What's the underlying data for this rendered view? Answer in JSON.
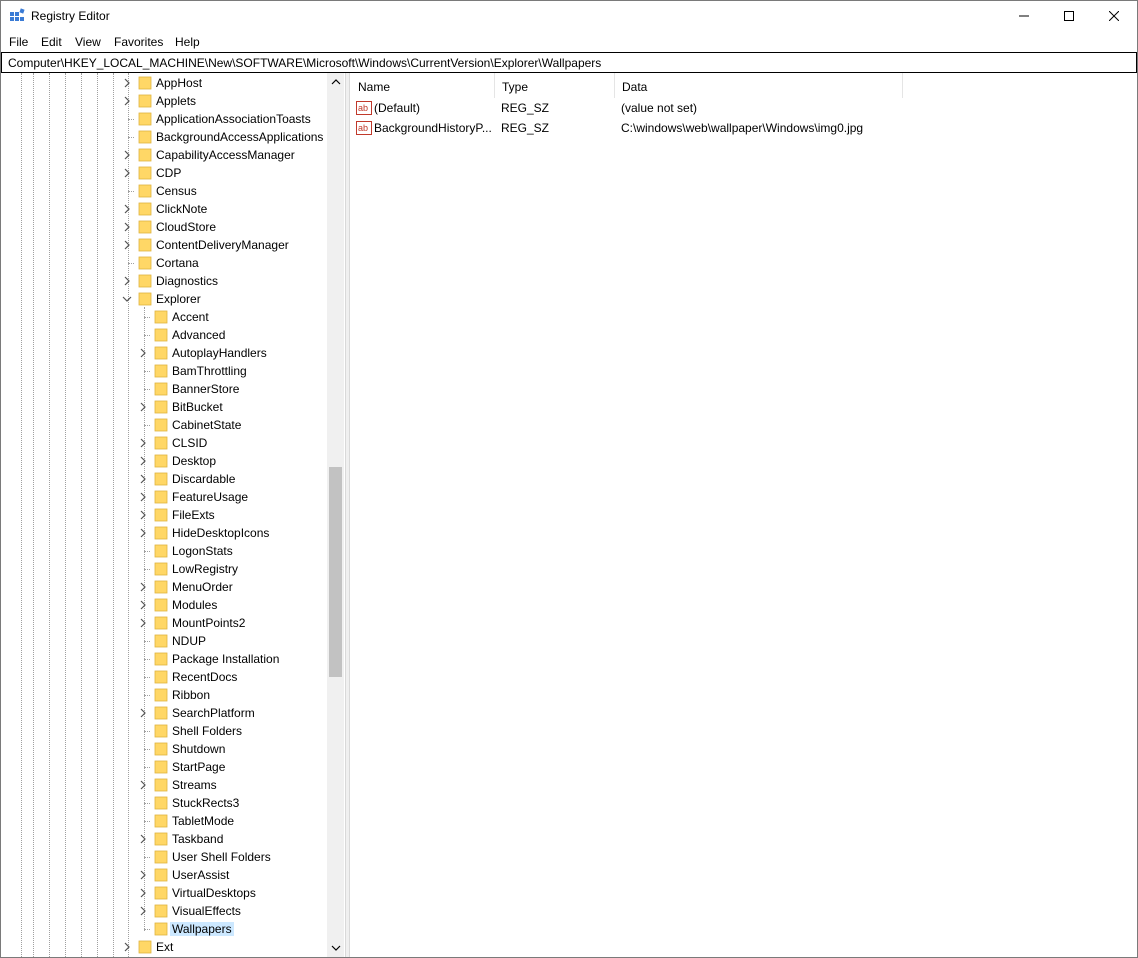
{
  "window": {
    "title": "Registry Editor"
  },
  "menu": [
    "File",
    "Edit",
    "View",
    "Favorites",
    "Help"
  ],
  "address": "Computer\\HKEY_LOCAL_MACHINE\\New\\SOFTWARE\\Microsoft\\Windows\\CurrentVersion\\Explorer\\Wallpapers",
  "tree": {
    "items": [
      {
        "label": "AppHost",
        "level": 1,
        "expander": "collapsed"
      },
      {
        "label": "Applets",
        "level": 1,
        "expander": "collapsed"
      },
      {
        "label": "ApplicationAssociationToasts",
        "level": 1,
        "expander": "none"
      },
      {
        "label": "BackgroundAccessApplications",
        "level": 1,
        "expander": "none"
      },
      {
        "label": "CapabilityAccessManager",
        "level": 1,
        "expander": "collapsed"
      },
      {
        "label": "CDP",
        "level": 1,
        "expander": "collapsed"
      },
      {
        "label": "Census",
        "level": 1,
        "expander": "none"
      },
      {
        "label": "ClickNote",
        "level": 1,
        "expander": "collapsed"
      },
      {
        "label": "CloudStore",
        "level": 1,
        "expander": "collapsed"
      },
      {
        "label": "ContentDeliveryManager",
        "level": 1,
        "expander": "collapsed"
      },
      {
        "label": "Cortana",
        "level": 1,
        "expander": "none"
      },
      {
        "label": "Diagnostics",
        "level": 1,
        "expander": "collapsed"
      },
      {
        "label": "Explorer",
        "level": 1,
        "expander": "expanded"
      },
      {
        "label": "Accent",
        "level": 2,
        "expander": "none"
      },
      {
        "label": "Advanced",
        "level": 2,
        "expander": "none"
      },
      {
        "label": "AutoplayHandlers",
        "level": 2,
        "expander": "collapsed"
      },
      {
        "label": "BamThrottling",
        "level": 2,
        "expander": "none"
      },
      {
        "label": "BannerStore",
        "level": 2,
        "expander": "none"
      },
      {
        "label": "BitBucket",
        "level": 2,
        "expander": "collapsed"
      },
      {
        "label": "CabinetState",
        "level": 2,
        "expander": "none"
      },
      {
        "label": "CLSID",
        "level": 2,
        "expander": "collapsed"
      },
      {
        "label": "Desktop",
        "level": 2,
        "expander": "collapsed"
      },
      {
        "label": "Discardable",
        "level": 2,
        "expander": "collapsed"
      },
      {
        "label": "FeatureUsage",
        "level": 2,
        "expander": "collapsed"
      },
      {
        "label": "FileExts",
        "level": 2,
        "expander": "collapsed"
      },
      {
        "label": "HideDesktopIcons",
        "level": 2,
        "expander": "collapsed"
      },
      {
        "label": "LogonStats",
        "level": 2,
        "expander": "none"
      },
      {
        "label": "LowRegistry",
        "level": 2,
        "expander": "none"
      },
      {
        "label": "MenuOrder",
        "level": 2,
        "expander": "collapsed"
      },
      {
        "label": "Modules",
        "level": 2,
        "expander": "collapsed"
      },
      {
        "label": "MountPoints2",
        "level": 2,
        "expander": "collapsed"
      },
      {
        "label": "NDUP",
        "level": 2,
        "expander": "none"
      },
      {
        "label": "Package Installation",
        "level": 2,
        "expander": "none"
      },
      {
        "label": "RecentDocs",
        "level": 2,
        "expander": "none"
      },
      {
        "label": "Ribbon",
        "level": 2,
        "expander": "none"
      },
      {
        "label": "SearchPlatform",
        "level": 2,
        "expander": "collapsed"
      },
      {
        "label": "Shell Folders",
        "level": 2,
        "expander": "none"
      },
      {
        "label": "Shutdown",
        "level": 2,
        "expander": "none"
      },
      {
        "label": "StartPage",
        "level": 2,
        "expander": "none"
      },
      {
        "label": "Streams",
        "level": 2,
        "expander": "collapsed"
      },
      {
        "label": "StuckRects3",
        "level": 2,
        "expander": "none"
      },
      {
        "label": "TabletMode",
        "level": 2,
        "expander": "none"
      },
      {
        "label": "Taskband",
        "level": 2,
        "expander": "collapsed"
      },
      {
        "label": "User Shell Folders",
        "level": 2,
        "expander": "none"
      },
      {
        "label": "UserAssist",
        "level": 2,
        "expander": "collapsed"
      },
      {
        "label": "VirtualDesktops",
        "level": 2,
        "expander": "collapsed"
      },
      {
        "label": "VisualEffects",
        "level": 2,
        "expander": "collapsed"
      },
      {
        "label": "Wallpapers",
        "level": 2,
        "expander": "none",
        "selected": true
      },
      {
        "label": "Ext",
        "level": 1,
        "expander": "collapsed"
      }
    ]
  },
  "list": {
    "columns": [
      "Name",
      "Type",
      "Data"
    ],
    "rows": [
      {
        "name": "(Default)",
        "type": "REG_SZ",
        "data": "(value not set)",
        "icon": "string-value-icon"
      },
      {
        "name": "BackgroundHistoryP...",
        "type": "REG_SZ",
        "data": "C:\\windows\\web\\wallpaper\\Windows\\img0.jpg",
        "icon": "string-value-icon"
      }
    ]
  },
  "colors": {
    "selection": "#cce8ff",
    "folder": "#ffd766",
    "ab_icon": "#c0392b"
  }
}
